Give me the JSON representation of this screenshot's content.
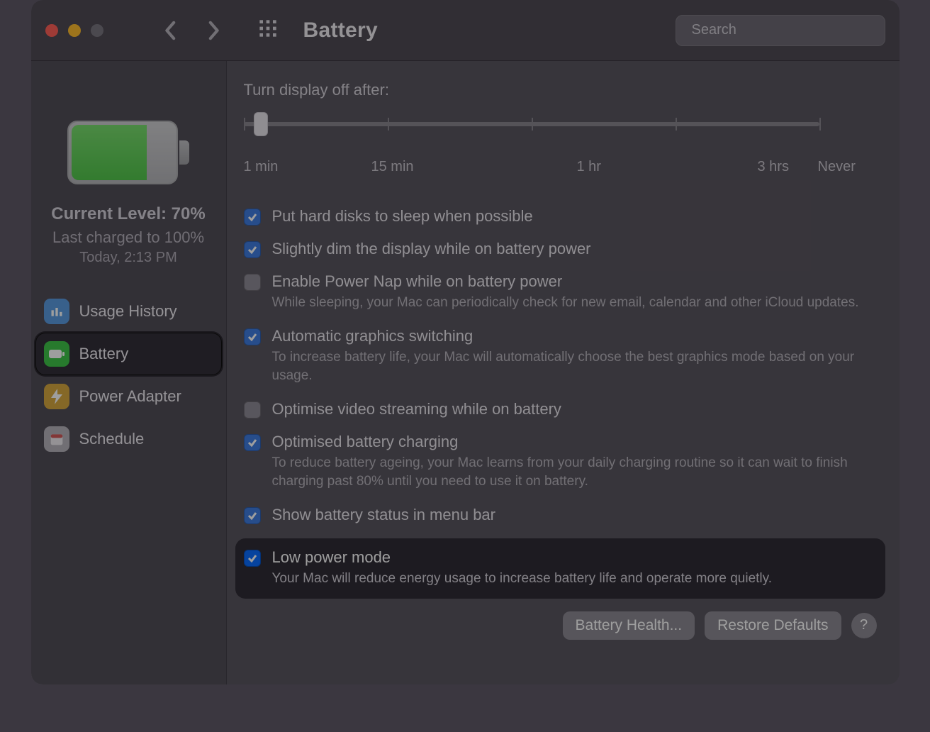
{
  "window": {
    "title": "Battery",
    "search_placeholder": "Search"
  },
  "sidebar": {
    "current_level": "Current Level: 70%",
    "last_charged": "Last charged to 100%",
    "last_charged_time": "Today, 2:13 PM",
    "items": [
      {
        "label": "Usage History"
      },
      {
        "label": "Battery"
      },
      {
        "label": "Power Adapter"
      },
      {
        "label": "Schedule"
      }
    ]
  },
  "content": {
    "slider_label": "Turn display off after:",
    "slider_ticks": [
      "1 min",
      "15 min",
      "1 hr",
      "3 hrs",
      "Never"
    ],
    "options": [
      {
        "checked": true,
        "label": "Put hard disks to sleep when possible",
        "sub": ""
      },
      {
        "checked": true,
        "label": "Slightly dim the display while on battery power",
        "sub": ""
      },
      {
        "checked": false,
        "label": "Enable Power Nap while on battery power",
        "sub": "While sleeping, your Mac can periodically check for new email, calendar and other iCloud updates."
      },
      {
        "checked": true,
        "label": "Automatic graphics switching",
        "sub": "To increase battery life, your Mac will automatically choose the best graphics mode based on your usage."
      },
      {
        "checked": false,
        "label": "Optimise video streaming while on battery",
        "sub": ""
      },
      {
        "checked": true,
        "label": "Optimised battery charging",
        "sub": "To reduce battery ageing, your Mac learns from your daily charging routine so it can wait to finish charging past 80% until you need to use it on battery."
      },
      {
        "checked": true,
        "label": "Show battery status in menu bar",
        "sub": ""
      },
      {
        "checked": true,
        "label": "Low power mode",
        "sub": "Your Mac will reduce energy usage to increase battery life and operate more quietly."
      }
    ],
    "buttons": {
      "health": "Battery Health...",
      "restore": "Restore Defaults",
      "help": "?"
    }
  }
}
